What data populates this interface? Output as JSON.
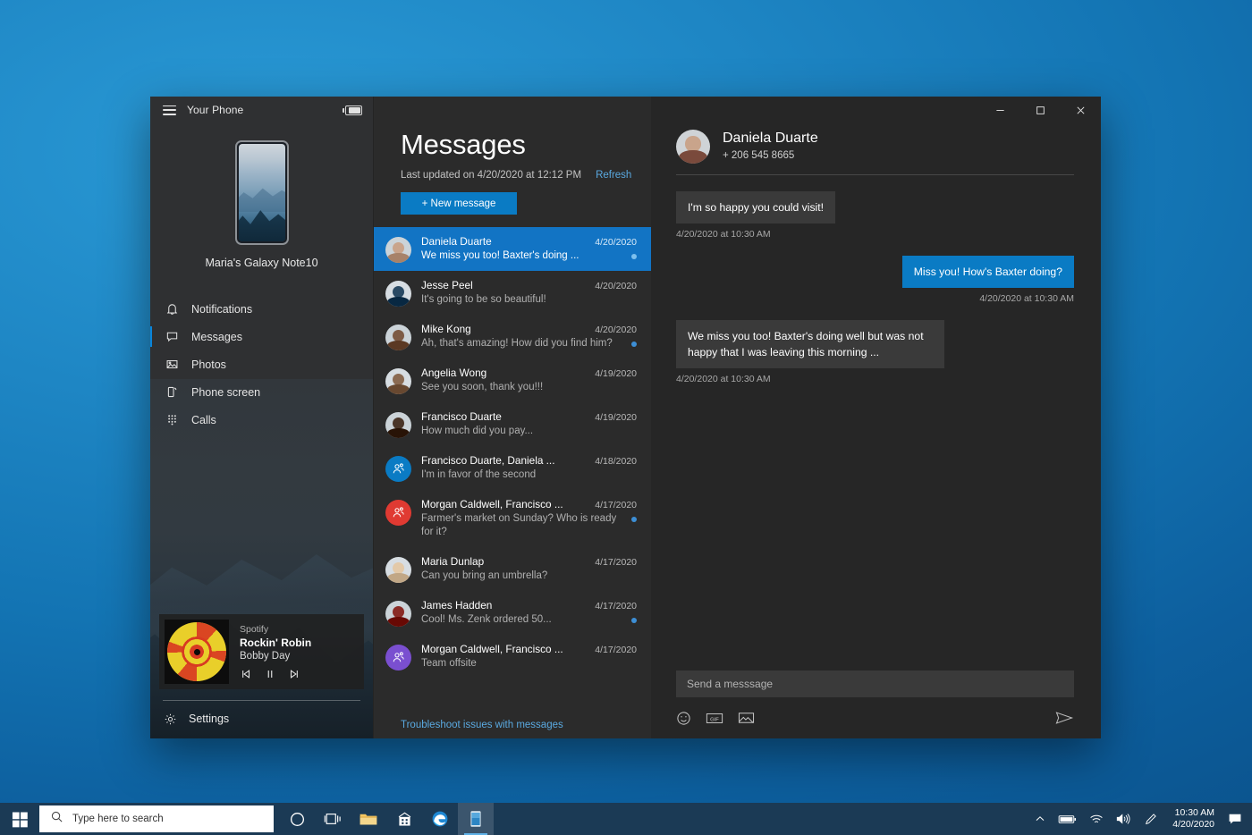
{
  "window": {
    "title": "Your Phone",
    "menu_icon": "hamburger-icon",
    "battery_icon": "battery-icon",
    "minimize_label": "–",
    "maximize_label": "☐",
    "close_label": "✕"
  },
  "sidebar": {
    "device_name": "Maria's Galaxy Note10",
    "nav": [
      {
        "label": "Notifications",
        "icon": "bell-icon",
        "active": false
      },
      {
        "label": "Messages",
        "icon": "chat-bubble-icon",
        "active": true
      },
      {
        "label": "Photos",
        "icon": "photo-icon",
        "active": false
      },
      {
        "label": "Phone screen",
        "icon": "phone-screen-icon",
        "active": false
      },
      {
        "label": "Calls",
        "icon": "dialpad-icon",
        "active": false
      }
    ],
    "media": {
      "app": "Spotify",
      "track": "Rockin' Robin",
      "artist": "Bobby Day",
      "previous_label": "previous-track-icon",
      "pause_label": "pause-icon",
      "next_label": "next-track-icon"
    },
    "settings": {
      "label": "Settings",
      "icon": "gear-icon"
    }
  },
  "messages_panel": {
    "title": "Messages",
    "last_updated": "Last updated on 4/20/2020 at 12:12 PM",
    "refresh_label": "Refresh",
    "new_message_label": "+ New message",
    "troubleshoot_label": "Troubleshoot issues with messages",
    "conversations": [
      {
        "name": "Daniela Duarte",
        "preview": "We miss you too! Baxter's doing ...",
        "date": "4/20/2020",
        "unread": true,
        "selected": true,
        "avatar": "photo",
        "avatar_color": "#c9a48b"
      },
      {
        "name": "Jesse Peel",
        "preview": "It's going to be so beautiful!",
        "date": "4/20/2020",
        "unread": false,
        "selected": false,
        "avatar": "photo",
        "avatar_color": "#2a4a64"
      },
      {
        "name": "Mike Kong",
        "preview": "Ah, that's amazing! How did you find him?",
        "date": "4/20/2020",
        "unread": true,
        "selected": false,
        "avatar": "photo",
        "avatar_color": "#7d5b45"
      },
      {
        "name": "Angelia Wong",
        "preview": "See you soon, thank you!!!",
        "date": "4/19/2020",
        "unread": false,
        "selected": false,
        "avatar": "photo",
        "avatar_color": "#8a6a52"
      },
      {
        "name": "Francisco Duarte",
        "preview": "How much did you pay...",
        "date": "4/19/2020",
        "unread": false,
        "selected": false,
        "avatar": "photo",
        "avatar_color": "#4a3528"
      },
      {
        "name": "Francisco Duarte, Daniela ...",
        "preview": "I'm in favor of the second",
        "date": "4/18/2020",
        "unread": false,
        "selected": false,
        "avatar": "group",
        "avatar_color": "#0a7bc4"
      },
      {
        "name": "Morgan Caldwell, Francisco ...",
        "preview": "Farmer's market on Sunday? Who is ready for it?",
        "date": "4/17/2020",
        "unread": true,
        "selected": false,
        "avatar": "group",
        "avatar_color": "#e03a32"
      },
      {
        "name": "Maria Dunlap",
        "preview": "Can you bring an umbrella?",
        "date": "4/17/2020",
        "unread": false,
        "selected": false,
        "avatar": "photo",
        "avatar_color": "#e3c9a8"
      },
      {
        "name": "James Hadden",
        "preview": "Cool! Ms. Zenk ordered 50...",
        "date": "4/17/2020",
        "unread": true,
        "selected": false,
        "avatar": "photo",
        "avatar_color": "#8a2b26"
      },
      {
        "name": "Morgan Caldwell, Francisco ...",
        "preview": "Team offsite",
        "date": "4/17/2020",
        "unread": false,
        "selected": false,
        "avatar": "group",
        "avatar_color": "#7a4fd0"
      }
    ]
  },
  "chat": {
    "contact_name": "Daniela Duarte",
    "contact_phone": "+ 206 545 8665",
    "messages": [
      {
        "direction": "in",
        "text": "I'm so happy you could visit!",
        "time": "4/20/2020 at 10:30 AM"
      },
      {
        "direction": "out",
        "text": "Miss you! How's Baxter doing?",
        "time": "4/20/2020 at 10:30 AM"
      },
      {
        "direction": "in",
        "text": "We miss you too! Baxter's doing well but was not happy that I was leaving this morning ...",
        "time": "4/20/2020 at 10:30 AM"
      }
    ],
    "composer": {
      "placeholder": "Send a messsage",
      "value": "",
      "emoji_icon": "emoji-icon",
      "gif_icon": "gif-icon",
      "image_icon": "image-icon",
      "send_icon": "send-icon"
    }
  },
  "taskbar": {
    "start_icon": "windows-start-icon",
    "search_placeholder": "Type here to search",
    "search_icon": "search-icon",
    "buttons": [
      {
        "name": "cortana-icon",
        "active": false
      },
      {
        "name": "task-view-icon",
        "active": false
      },
      {
        "name": "file-explorer-icon",
        "active": false
      },
      {
        "name": "microsoft-store-icon",
        "active": false
      },
      {
        "name": "microsoft-edge-icon",
        "active": false
      },
      {
        "name": "your-phone-icon",
        "active": true
      }
    ],
    "tray": {
      "chevron_icon": "chevron-up-icon",
      "battery_icon": "battery-icon",
      "wifi_icon": "wifi-icon",
      "volume_icon": "volume-icon",
      "pen_icon": "pen-icon",
      "notification_icon": "action-center-icon",
      "time": "10:30 AM",
      "date": "4/20/2020"
    }
  },
  "colors": {
    "accent": "#0a7bc4",
    "selected_row": "#1274c4",
    "link": "#5aa9e0",
    "unread_dot": "#3d8fd6"
  }
}
